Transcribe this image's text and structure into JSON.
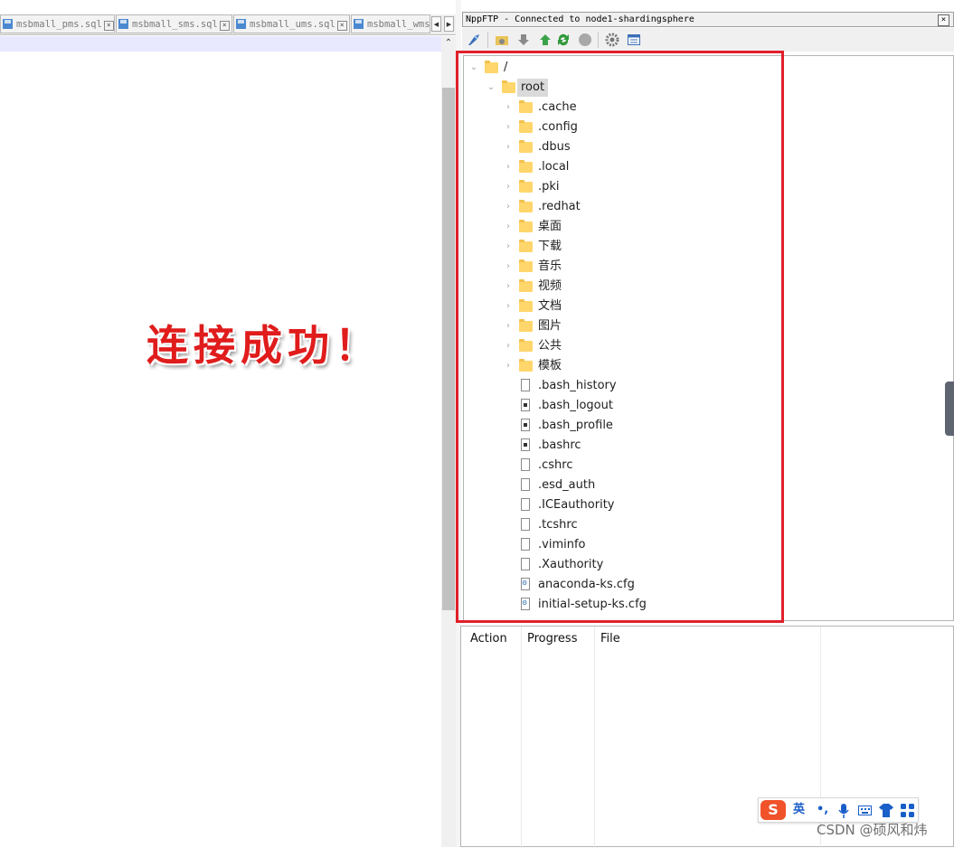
{
  "editor": {
    "tabs": [
      "msbmall_pms.sql",
      "msbmall_sms.sql",
      "msbmall_ums.sql",
      "msbmall_wms"
    ],
    "overlay_text": "连接成功！"
  },
  "ftp": {
    "title": "NppFTP - Connected to node1-shardingsphere",
    "tree": {
      "root": "/",
      "home": "root",
      "folders": [
        ".cache",
        ".config",
        ".dbus",
        ".local",
        ".pki",
        ".redhat",
        "桌面",
        "下载",
        "音乐",
        "视频",
        "文档",
        "图片",
        "公共",
        "模板"
      ],
      "files": [
        {
          "name": ".bash_history",
          "icon": "text-file-icon"
        },
        {
          "name": ".bash_logout",
          "icon": "script-file-icon"
        },
        {
          "name": ".bash_profile",
          "icon": "script-file-icon"
        },
        {
          "name": ".bashrc",
          "icon": "script-file-icon"
        },
        {
          "name": ".cshrc",
          "icon": "text-file-icon"
        },
        {
          "name": ".esd_auth",
          "icon": "text-file-icon"
        },
        {
          "name": ".ICEauthority",
          "icon": "text-file-icon"
        },
        {
          "name": ".tcshrc",
          "icon": "text-file-icon"
        },
        {
          "name": ".viminfo",
          "icon": "text-file-icon"
        },
        {
          "name": ".Xauthority",
          "icon": "text-file-icon"
        },
        {
          "name": "anaconda-ks.cfg",
          "icon": "config-file-icon"
        },
        {
          "name": "initial-setup-ks.cfg",
          "icon": "config-file-icon"
        }
      ]
    },
    "queue": {
      "columns": [
        "Action",
        "Progress",
        "File"
      ]
    }
  },
  "ime": {
    "logo": "S",
    "lang": "英",
    "punct": "•,"
  },
  "watermark": "CSDN @硕风和炜",
  "colors": {
    "highlight_box": "#e0202a",
    "overlay_text": "#e01c1c",
    "folder": "#ffd66b"
  }
}
